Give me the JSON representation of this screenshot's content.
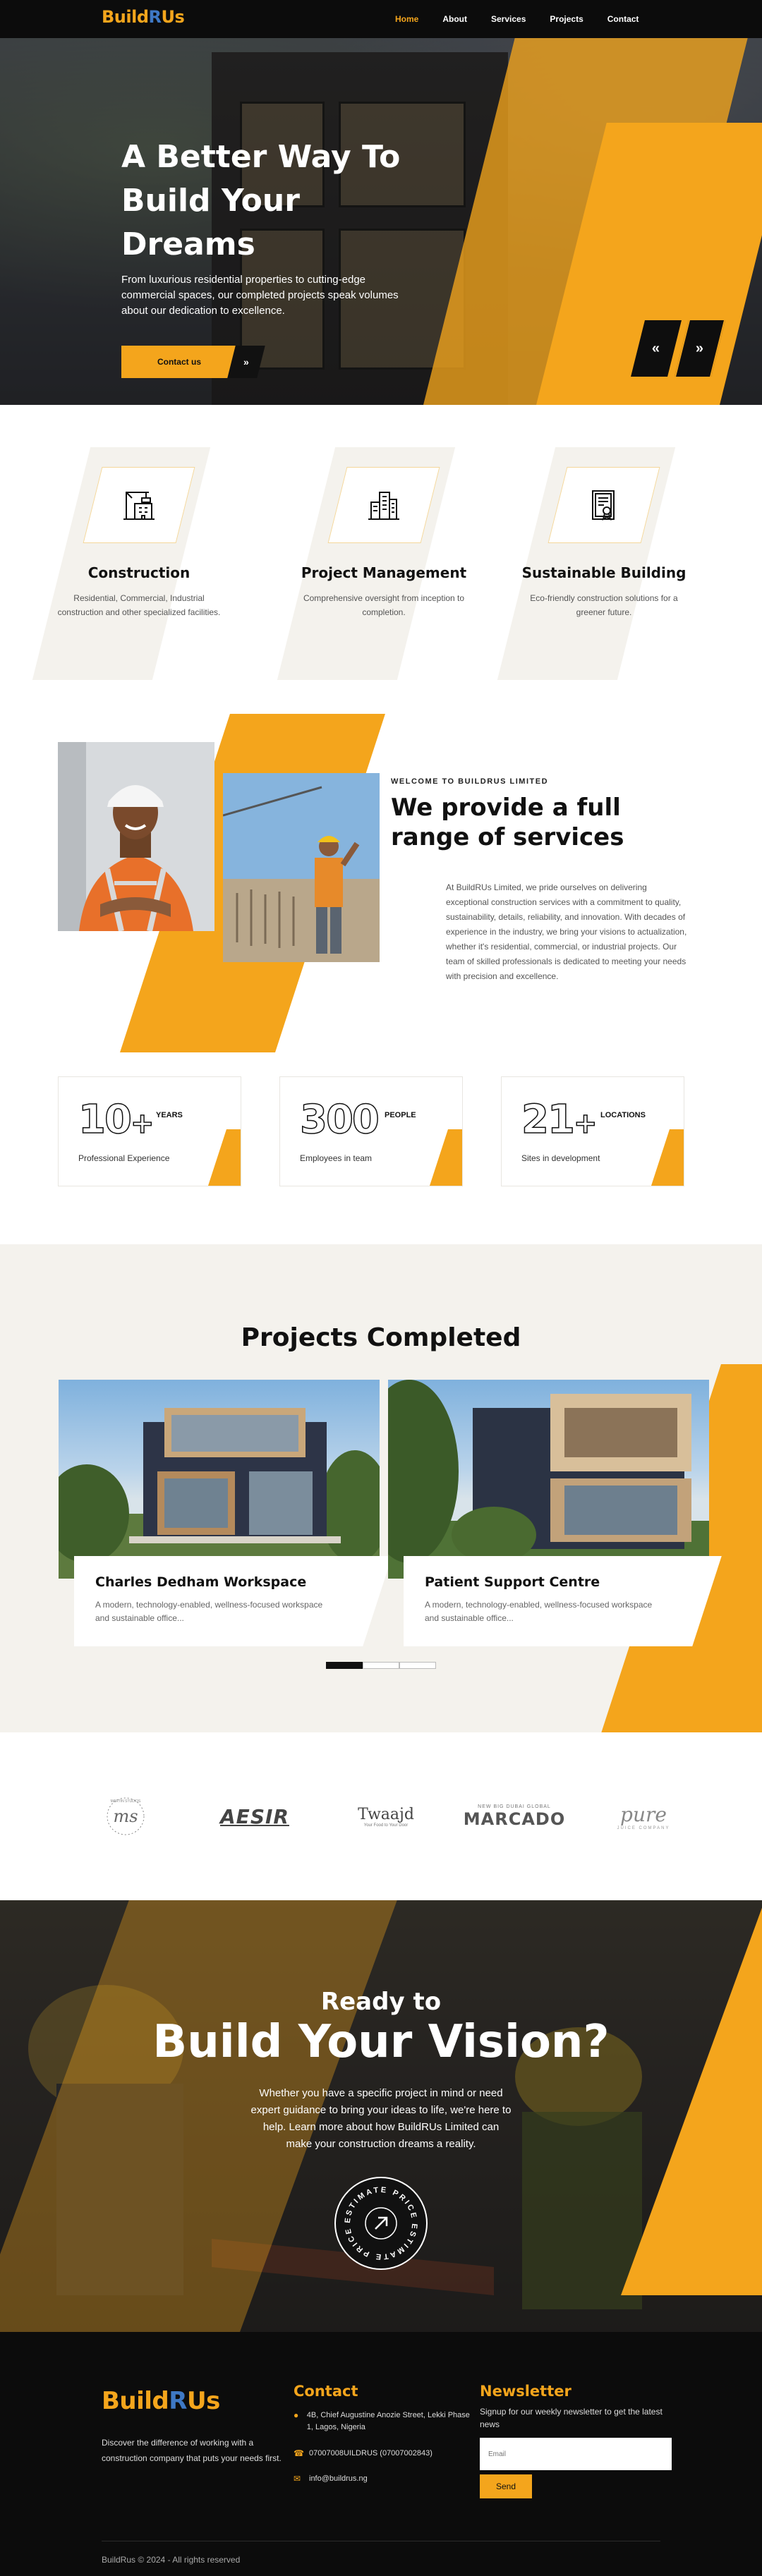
{
  "brand": {
    "name_part1": "Build",
    "name_r": "R",
    "name_part2": "Us"
  },
  "nav": [
    {
      "label": "Home",
      "active": true
    },
    {
      "label": "About"
    },
    {
      "label": "Services"
    },
    {
      "label": "Projects"
    },
    {
      "label": "Contact"
    }
  ],
  "hero": {
    "title": "A Better Way To Build Your Dreams",
    "subtitle": "From luxurious residential properties to cutting-edge commercial spaces, our completed projects speak volumes about our dedication to excellence.",
    "cta_label": "Contact us",
    "cta_arrow": "»",
    "prev": "«",
    "next": "»"
  },
  "features": [
    {
      "title": "Construction",
      "text": "Residential, Commercial, Industrial construction and other specialized facilities.",
      "icon": "crane-building-icon"
    },
    {
      "title": "Project Management",
      "text": "Comprehensive oversight from inception to completion.",
      "icon": "city-buildings-icon"
    },
    {
      "title": "Sustainable Building",
      "text": "Eco-friendly construction solutions for a greener future.",
      "icon": "certificate-document-icon"
    }
  ],
  "about": {
    "eyebrow": "WELCOME TO BUILDRUS LIMITED",
    "title": "We provide a full range of services",
    "body": "At BuildRUs Limited, we pride ourselves on delivering exceptional construction services with a commitment to quality, sustainability, details, reliability, and innovation. With decades of experience in the industry, we bring your visions to actualization, whether it's residential, commercial, or industrial projects. Our team of skilled professionals is dedicated to meeting your needs with precision and excellence."
  },
  "stats": [
    {
      "number": "10",
      "plus": "+",
      "unit": "YEARS",
      "label": "Professional Experience"
    },
    {
      "number": "300",
      "plus": "",
      "unit": "PEOPLE",
      "label": "Employees in team"
    },
    {
      "number": "21",
      "plus": "+",
      "unit": "LOCATIONS",
      "label": "Sites in development"
    }
  ],
  "projects": {
    "title": "Projects Completed",
    "items": [
      {
        "title": "Charles Dedham Workspace",
        "text": "A modern, technology-enabled, wellness-focused workspace and sustainable office..."
      },
      {
        "title": "Patient Support Centre",
        "text": "A modern, technology-enabled, wellness-focused workspace and sustainable office..."
      }
    ]
  },
  "clients": [
    {
      "name": "ms",
      "sub": "MARTIN STUDIOS"
    },
    {
      "name": "AESIR"
    },
    {
      "name": "Twaajd",
      "sub": "Your Food to Your Door"
    },
    {
      "name": "MARCADO",
      "sub": "NEW BIG DUBAI GLOBAL"
    },
    {
      "name": "pure",
      "sub": "JUICE COMPANY"
    }
  ],
  "cta": {
    "pre": "Ready to",
    "title": "Build Your Vision?",
    "text": "Whether you have a specific project in mind or need expert guidance to bring your ideas to life, we're here to help. Learn more about how BuildRUs Limited can make your construction dreams a reality.",
    "badge": "ESTIMATE PRICE"
  },
  "footer": {
    "description": "Discover the difference of working with a construction company that puts your needs first.",
    "contact_title": "Contact",
    "address": "4B, Chief Augustine Anozie Street, Lekki Phase 1, Lagos, Nigeria",
    "phone": "07007008UILDRUS (07007002843)",
    "email": "info@buildrus.ng",
    "newsletter_title": "Newsletter",
    "newsletter_text": "Signup for our weekly newsletter to get the latest news",
    "email_placeholder": "Email",
    "send_label": "Send",
    "copyright": "BuildRus © 2024 - All rights reserved"
  },
  "colors": {
    "accent": "#f4a51c",
    "dark": "#0c0c0c",
    "brand_r": "#3e78c4",
    "cream": "#f4f2ed"
  }
}
